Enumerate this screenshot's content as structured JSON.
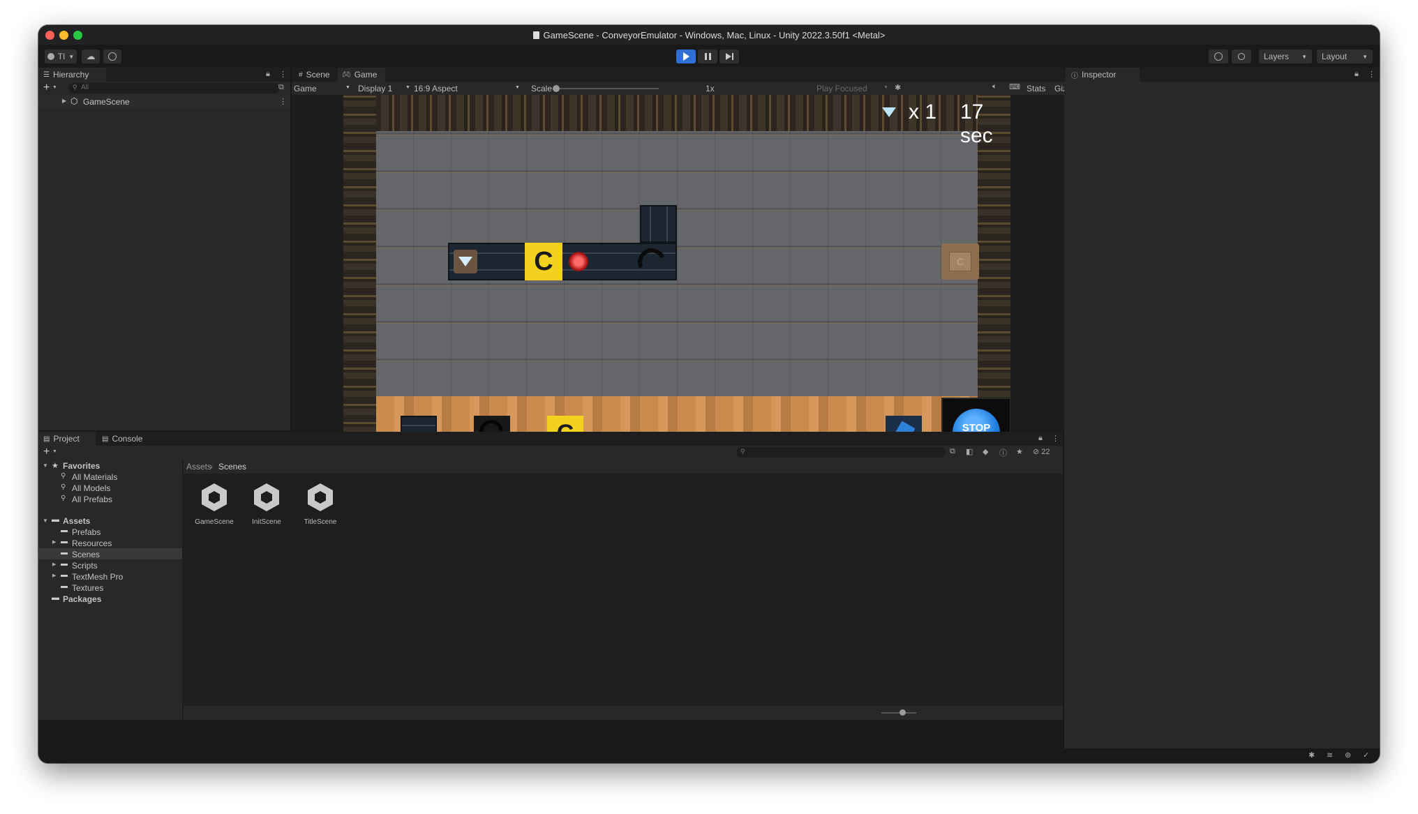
{
  "window": {
    "title": "GameScene - ConveyorEmulator - Windows, Mac, Linux - Unity 2022.3.50f1 <Metal>"
  },
  "toolbar": {
    "account_label": "TI",
    "layers_label": "Layers",
    "layout_label": "Layout"
  },
  "hierarchy": {
    "tab_label": "Hierarchy",
    "search_placeholder": "All",
    "scene_item": "GameScene"
  },
  "scene_tabs": {
    "scene_label": "Scene",
    "game_label": "Game"
  },
  "game_toolbar": {
    "game_dropdown": "Game",
    "display_dropdown": "Display 1",
    "aspect_dropdown": "16:9 Aspect",
    "scale_label": "Scale",
    "scale_value": "1x",
    "play_focused": "Play Focused",
    "stats_label": "Stats",
    "gizmos_label": "Gizmos"
  },
  "game_view": {
    "gem_count": "x 1",
    "timer": "17 sec",
    "c_tile_label": "C",
    "box_label": "C",
    "stop_label": "STOP"
  },
  "inspector": {
    "tab_label": "Inspector"
  },
  "project": {
    "project_tab": "Project",
    "console_tab": "Console",
    "hidden_count": "22",
    "favorites_label": "Favorites",
    "favorites": [
      "All Materials",
      "All Models",
      "All Prefabs"
    ],
    "assets_label": "Assets",
    "asset_folders": [
      "Prefabs",
      "Resources",
      "Scenes",
      "Scripts",
      "TextMesh Pro",
      "Textures"
    ],
    "packages_label": "Packages",
    "breadcrumb_root": "Assets",
    "breadcrumb_current": "Scenes",
    "scenes": [
      "GameScene",
      "InitScene",
      "TitleScene"
    ]
  },
  "colors": {
    "accent_blue": "#2f6fd6",
    "stop_button": "#1f7fe0",
    "c_tile": "#f2d21e",
    "wood": "#c98a4e"
  }
}
